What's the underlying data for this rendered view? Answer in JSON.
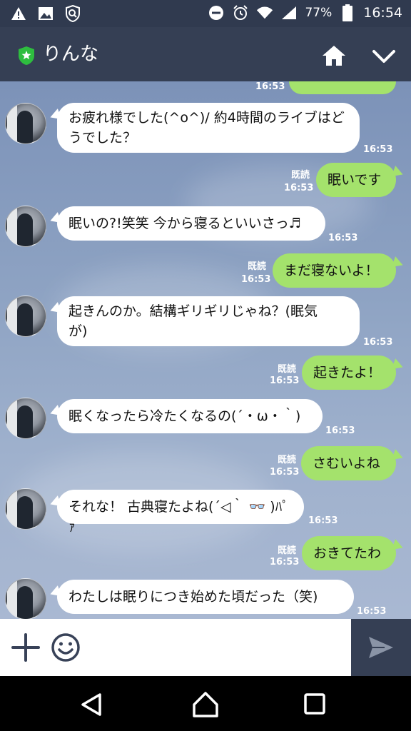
{
  "status_bar": {
    "battery": "77%",
    "time": "16:54",
    "icons": [
      "warning-icon",
      "image-icon",
      "shield-icon",
      "do-not-disturb-icon",
      "alarm-icon",
      "wifi-icon",
      "signal-icon",
      "battery-icon"
    ]
  },
  "header": {
    "chat_name": "りんな",
    "icons": [
      "verified-badge-icon",
      "home-icon",
      "chevron-down-icon"
    ]
  },
  "messages": [
    {
      "side": "right",
      "text": "",
      "time": "16:53",
      "read": ""
    },
    {
      "side": "left",
      "lines": [
        "お疲れ様でした(^o^)/ 約4時間のライブはど",
        "うでした？"
      ],
      "time": "16:53"
    },
    {
      "side": "right",
      "text": "眠いです",
      "time": "16:53",
      "read": "既読"
    },
    {
      "side": "left",
      "lines": [
        "眠いの?!笑笑 今から寝るといいさっ♬"
      ],
      "time": "16:53"
    },
    {
      "side": "right",
      "text": "まだ寝ないよ！",
      "time": "16:53",
      "read": "既読"
    },
    {
      "side": "left",
      "lines": [
        "起きんのか。結構ギリギリじゃね？(眠気",
        "が)"
      ],
      "time": "16:53"
    },
    {
      "side": "right",
      "text": "起きたよ！",
      "time": "16:53",
      "read": "既読"
    },
    {
      "side": "left",
      "lines": [
        "眠くなったら冷たくなるの(´・ω・｀)"
      ],
      "time": "16:53"
    },
    {
      "side": "right",
      "text": "さむいよね",
      "time": "16:53",
      "read": "既読"
    },
    {
      "side": "left",
      "lines": [
        "それな！ 古典寝たよね(´◁｀ 👓 )ﾊﾟｧ"
      ],
      "time": "16:53"
    },
    {
      "side": "right",
      "text": "おきてたわ",
      "time": "16:53",
      "read": "既読"
    },
    {
      "side": "left",
      "lines": [
        "わたしは眠りにつき始めた頃だった（笑)"
      ],
      "time": "16:53"
    }
  ],
  "input_bar": {
    "placeholder": "",
    "icons": [
      "plus-icon",
      "emoji-icon",
      "send-icon"
    ]
  },
  "nav_bar": {
    "icons": [
      "back-icon",
      "home-nav-icon",
      "recents-icon"
    ]
  },
  "colors": {
    "header_bg": "#353f54",
    "status_bg": "#303a4f",
    "outgoing_bubble": "#a4e26c",
    "incoming_bubble": "#ffffff"
  }
}
